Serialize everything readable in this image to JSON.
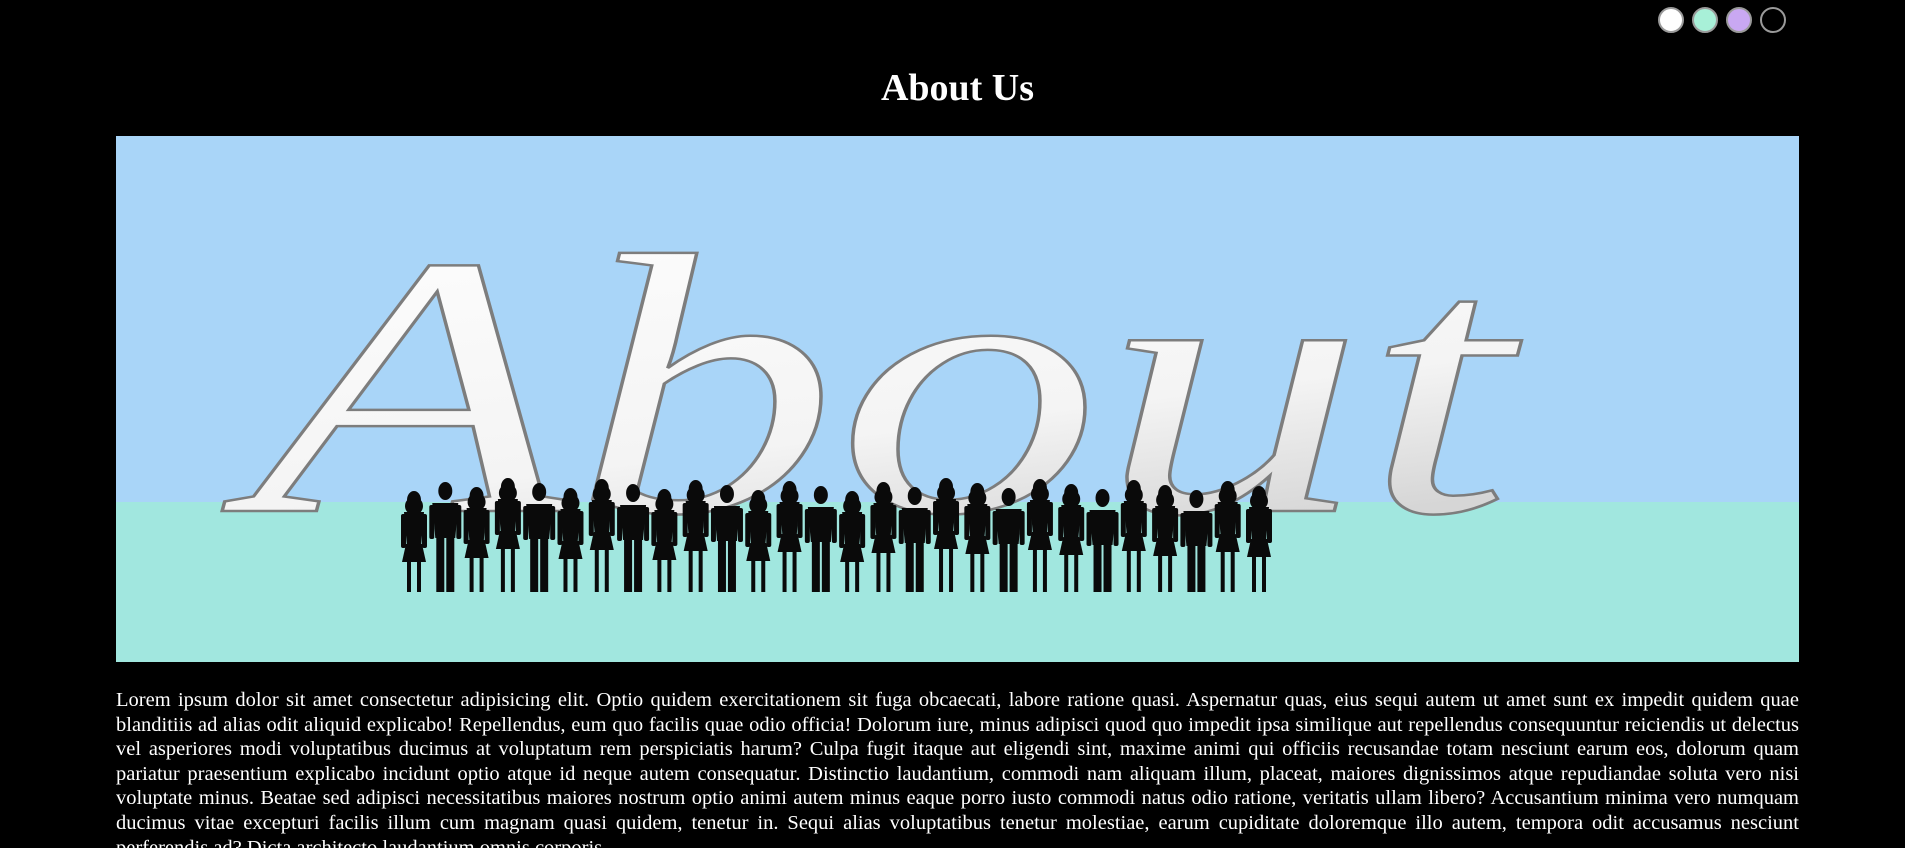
{
  "theme_switcher": {
    "swatches": [
      {
        "name": "white",
        "color": "#ffffff"
      },
      {
        "name": "mint",
        "color": "#a8f0d8"
      },
      {
        "name": "lavender",
        "color": "#c9a8f2"
      },
      {
        "name": "black",
        "color": "#000000"
      }
    ]
  },
  "page": {
    "title": "About Us"
  },
  "hero": {
    "word": "About",
    "sky_color": "#a9d5f8",
    "ground_color": "#a1e7df",
    "silhouette_color": "#0a0a0a",
    "people_count": 28
  },
  "content": {
    "paragraph": "Lorem ipsum dolor sit amet consectetur adipisicing elit. Optio quidem exercitationem sit fuga obcaecati, labore ratione quasi. Aspernatur quas, eius sequi autem ut amet sunt ex impedit quidem quae blanditiis ad alias odit aliquid explicabo! Repellendus, eum quo facilis quae odio officia! Dolorum iure, minus adipisci quod quo impedit ipsa similique aut repellendus consequuntur reiciendis ut delectus vel asperiores modi voluptatibus ducimus at voluptatum rem perspiciatis harum? Culpa fugit itaque aut eligendi sint, maxime animi qui officiis recusandae totam nesciunt earum eos, dolorum quam pariatur praesentium explicabo incidunt optio atque id neque autem consequatur. Distinctio laudantium, commodi nam aliquam illum, placeat, maiores dignissimos atque repudiandae soluta vero nisi voluptate minus. Beatae sed adipisci necessitatibus maiores nostrum optio animi autem minus eaque porro iusto commodi natus odio ratione, veritatis ullam libero? Accusantium minima vero numquam ducimus vitae excepturi facilis illum cum magnam quasi quidem, tenetur in. Sequi alias voluptatibus tenetur molestiae, earum cupiditate doloremque illo autem, tempora odit accusamus nesciunt perferendis ad? Dicta architecto laudantium omnis corporis"
  }
}
